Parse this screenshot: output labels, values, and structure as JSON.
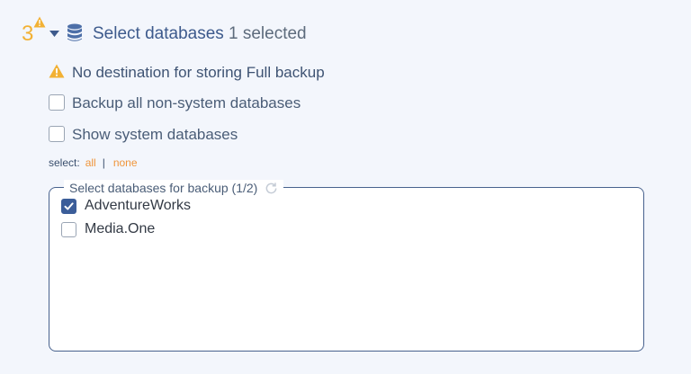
{
  "step": {
    "number": "3",
    "title": "Select databases",
    "count": "1 selected"
  },
  "warning": {
    "text": "No destination for storing Full backup"
  },
  "options": {
    "backup_all_label": "Backup all non-system databases",
    "show_system_label": "Show system databases",
    "backup_all_checked": false,
    "show_system_checked": false
  },
  "select": {
    "prefix": "select:",
    "all_label": "all",
    "separator": "|",
    "none_label": "none"
  },
  "database_box": {
    "legend": "Select databases for backup (1/2)",
    "items": [
      {
        "label": "AdventureWorks",
        "checked": true
      },
      {
        "label": "Media.One",
        "checked": false
      }
    ]
  },
  "colors": {
    "accent": "#3b5d99",
    "warning": "#f2b134",
    "link": "#f0953a",
    "background": "#f3f6fc"
  },
  "icons": {
    "step_status": "warning-icon",
    "collapse": "caret-down-icon",
    "section": "database-icon",
    "refresh": "refresh-icon"
  }
}
